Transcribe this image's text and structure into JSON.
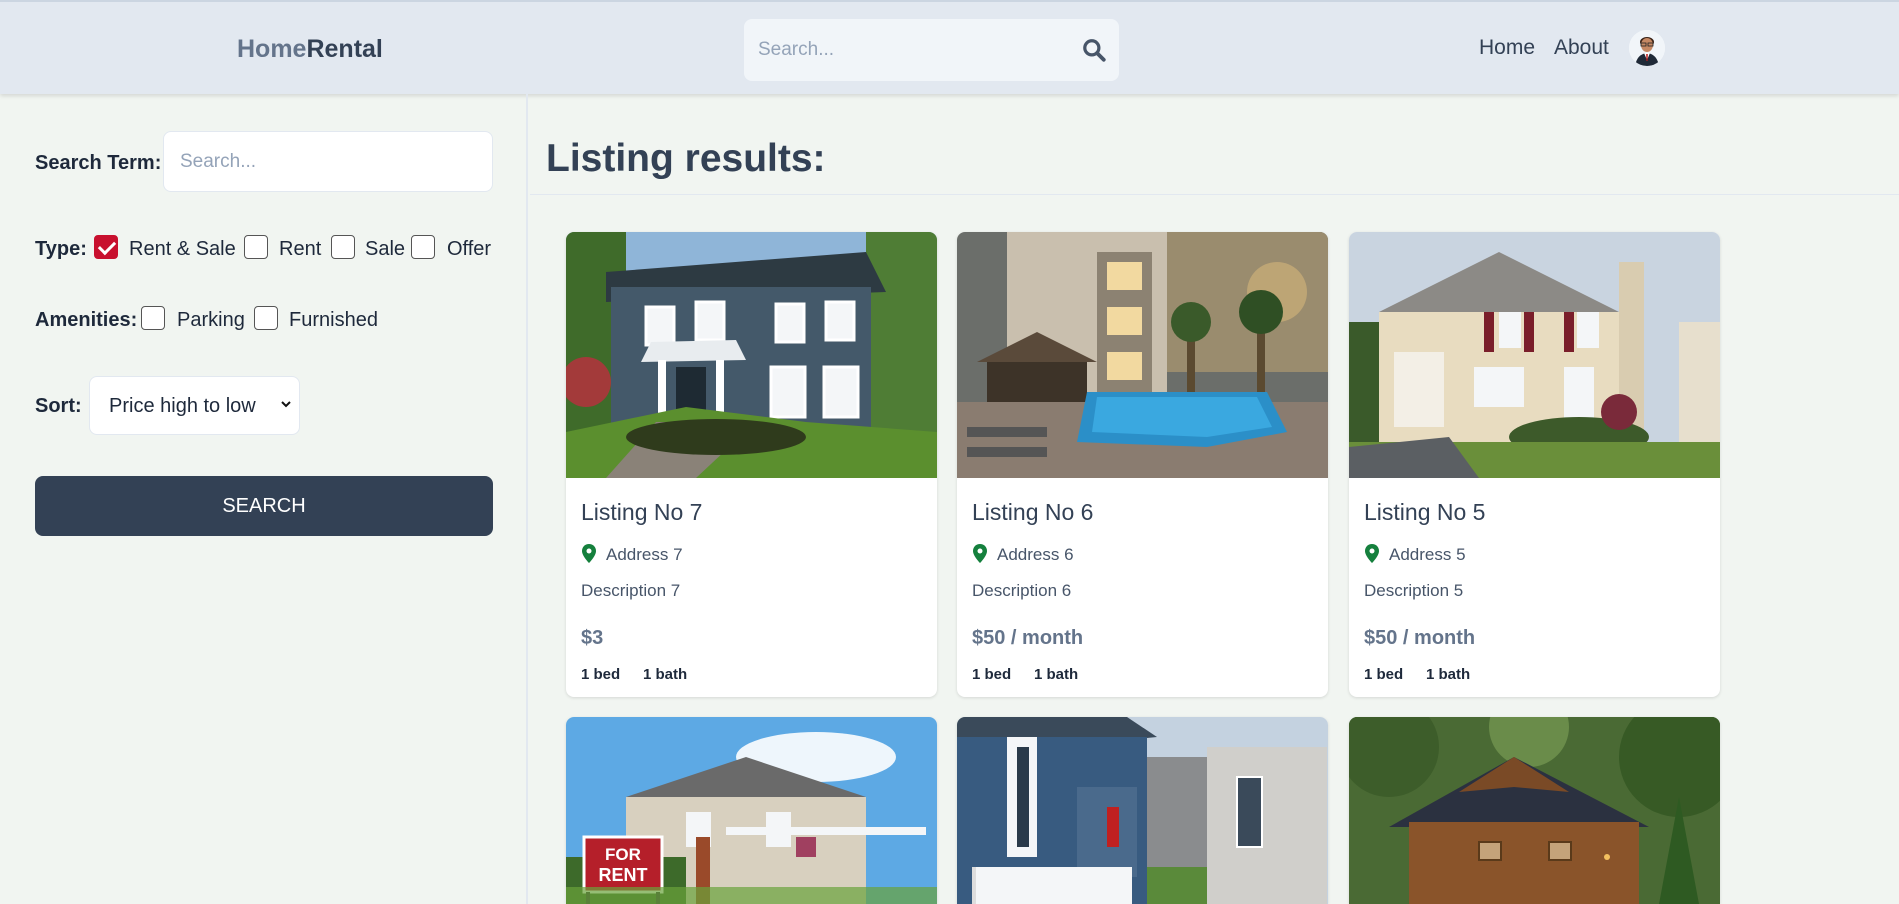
{
  "header": {
    "logo_home": "Home",
    "logo_rental": "Rental",
    "search_placeholder": "Search...",
    "nav_home": "Home",
    "nav_about": "About"
  },
  "filters": {
    "search_term_label": "Search Term:",
    "search_placeholder": "Search...",
    "type_label": "Type:",
    "type_options": [
      {
        "label": "Rent & Sale",
        "checked": true
      },
      {
        "label": "Rent",
        "checked": false
      },
      {
        "label": "Sale",
        "checked": false
      },
      {
        "label": "Offer",
        "checked": false
      }
    ],
    "amenities_label": "Amenities:",
    "amenities_options": [
      {
        "label": "Parking",
        "checked": false
      },
      {
        "label": "Furnished",
        "checked": false
      }
    ],
    "sort_label": "Sort:",
    "sort_value": "Price high to low",
    "search_button": "SEARCH"
  },
  "main": {
    "title": "Listing results:",
    "listings": [
      {
        "name": "Listing No 7",
        "address": "Address 7",
        "description": "Description 7",
        "price": "$3",
        "beds": "1 bed",
        "baths": "1 bath"
      },
      {
        "name": "Listing No 6",
        "address": "Address 6",
        "description": "Description 6",
        "price": "$50 / month",
        "beds": "1 bed",
        "baths": "1 bath"
      },
      {
        "name": "Listing No 5",
        "address": "Address 5",
        "description": "Description 5",
        "price": "$50 / month",
        "beds": "1 bed",
        "baths": "1 bath"
      }
    ],
    "for_rent_sign": "FOR RENT"
  },
  "colors": {
    "accent": "#334155",
    "checkbox_checked": "#c8102e",
    "pin": "#15803d",
    "header_bg": "#e2e8f0"
  }
}
